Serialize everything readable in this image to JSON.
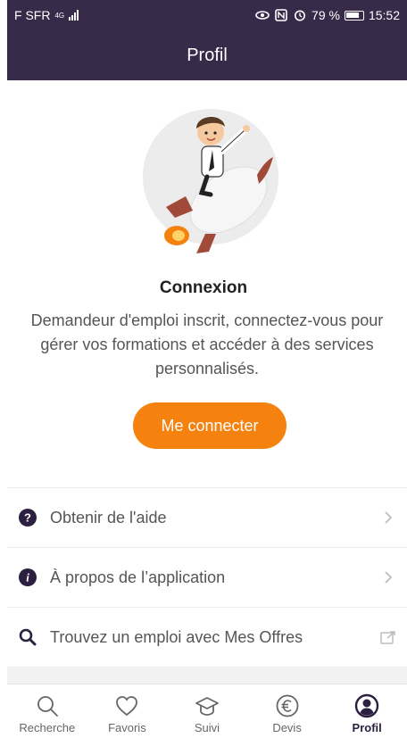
{
  "status_bar": {
    "carrier": "F SFR",
    "network": "4G",
    "battery_percent": "79 %",
    "time": "15:52"
  },
  "header": {
    "title": "Profil"
  },
  "hero": {
    "illustration_icon": "rocket-character-icon",
    "title": "Connexion",
    "description": "Demandeur d'emploi inscrit, connectez-vous pour gérer vos formations et accéder à des services personnalisés.",
    "button_label": "Me connecter"
  },
  "menu": {
    "items": [
      {
        "label": "Obtenir de l'aide",
        "icon": "question-circle-icon",
        "trailing": "chevron-right-icon"
      },
      {
        "label": "À propos de l’application",
        "icon": "info-circle-icon",
        "trailing": "chevron-right-icon"
      },
      {
        "label": "Trouvez un emploi avec Mes Offres",
        "icon": "search-icon",
        "trailing": "external-link-icon"
      }
    ]
  },
  "bottom_nav": {
    "tabs": [
      {
        "label": "Recherche",
        "icon": "search-icon"
      },
      {
        "label": "Favoris",
        "icon": "heart-icon"
      },
      {
        "label": "Suivi",
        "icon": "graduation-cap-icon"
      },
      {
        "label": "Devis",
        "icon": "euro-circle-icon"
      },
      {
        "label": "Profil",
        "icon": "user-circle-icon",
        "active": true
      }
    ]
  },
  "colors": {
    "header_bg": "#382b4a",
    "accent": "#f5820e",
    "icon_dark": "#2c2040"
  }
}
